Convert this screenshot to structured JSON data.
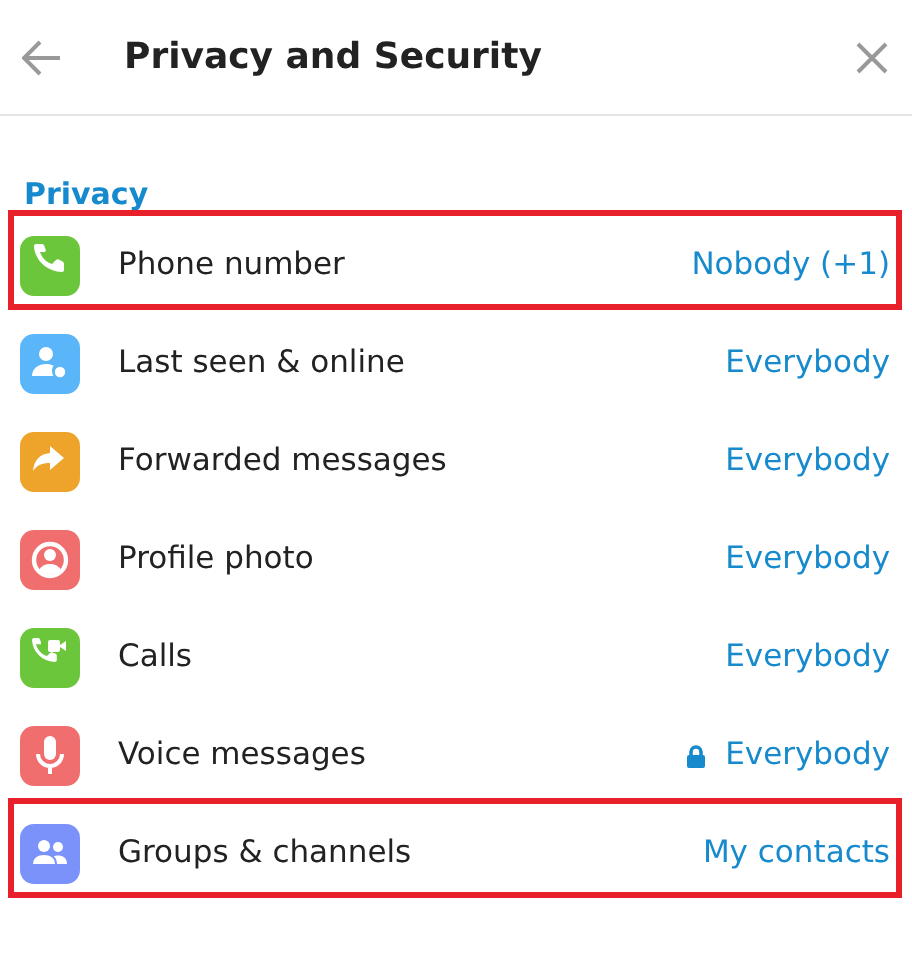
{
  "header": {
    "title": "Privacy and Security"
  },
  "section": {
    "title": "Privacy"
  },
  "rows": [
    {
      "label": "Phone number",
      "value": "Nobody (+1)",
      "kind": "phone",
      "color": "#6cc63b",
      "locked": false,
      "highlighted": true
    },
    {
      "label": "Last seen & online",
      "value": "Everybody",
      "kind": "person",
      "color": "#5bb5f9",
      "locked": false,
      "highlighted": false
    },
    {
      "label": "Forwarded messages",
      "value": "Everybody",
      "kind": "forward",
      "color": "#eea42b",
      "locked": false,
      "highlighted": false
    },
    {
      "label": "Profile photo",
      "value": "Everybody",
      "kind": "profile",
      "color": "#f06e6e",
      "locked": false,
      "highlighted": false
    },
    {
      "label": "Calls",
      "value": "Everybody",
      "kind": "videocall",
      "color": "#6cc63b",
      "locked": false,
      "highlighted": false
    },
    {
      "label": "Voice messages",
      "value": "Everybody",
      "kind": "mic",
      "color": "#f06e6e",
      "locked": true,
      "highlighted": false
    },
    {
      "label": "Groups & channels",
      "value": "My contacts",
      "kind": "group",
      "color": "#7c92fb",
      "locked": false,
      "highlighted": true
    }
  ]
}
